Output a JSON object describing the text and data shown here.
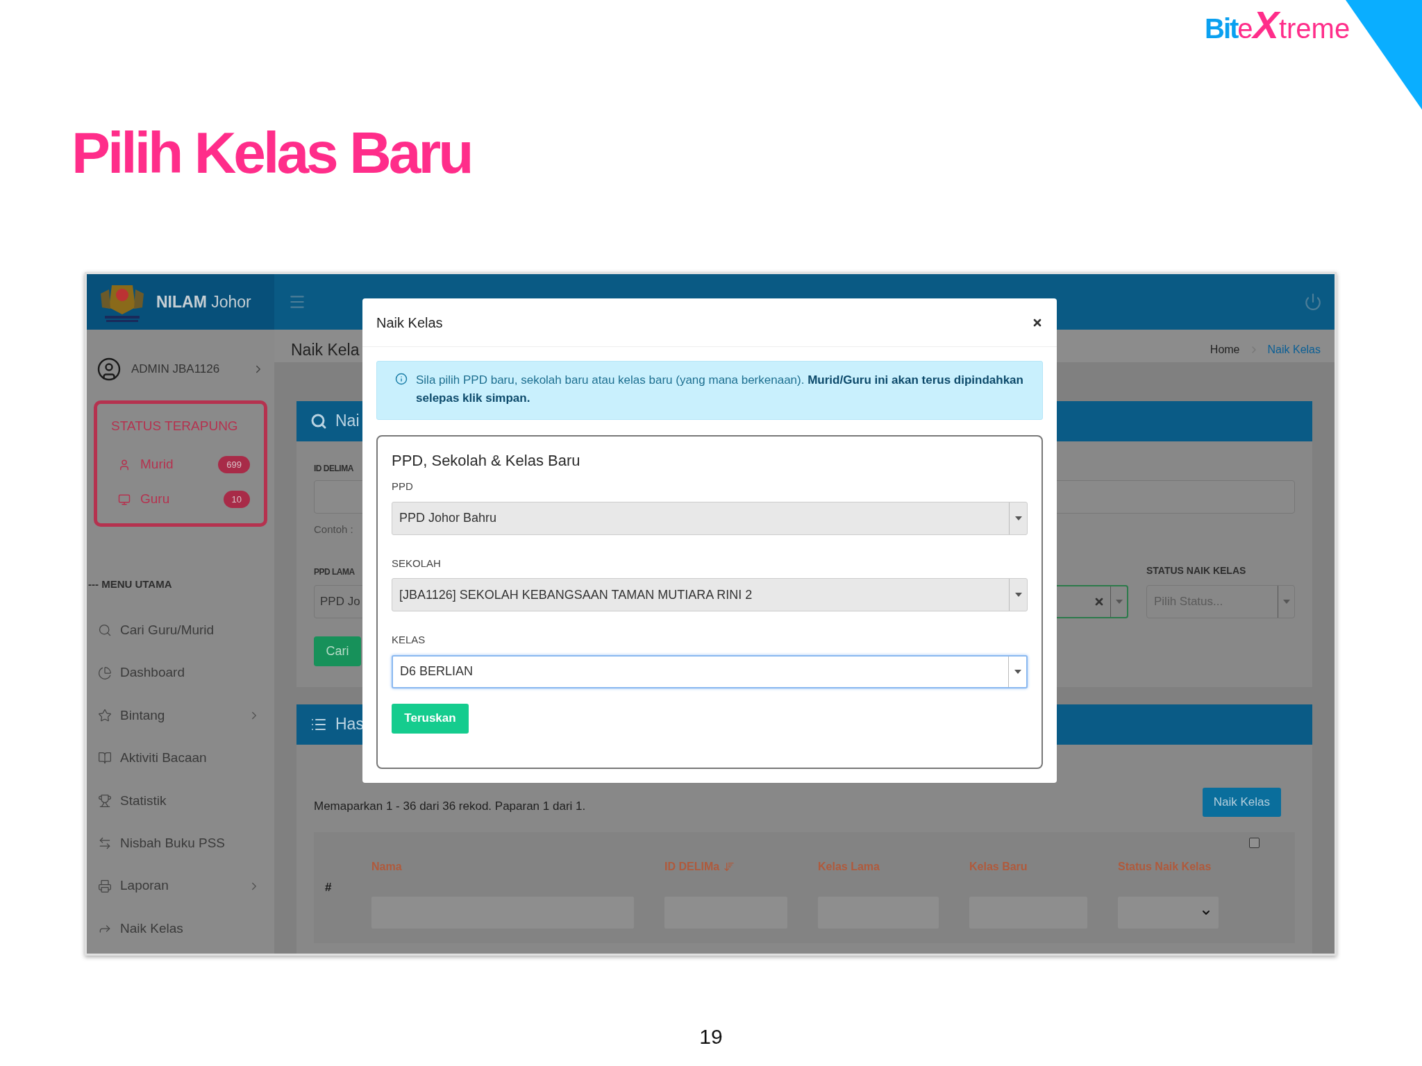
{
  "logo": {
    "parts": [
      {
        "kind": "bold",
        "text": "Bit"
      },
      {
        "kind": "light",
        "text": "e"
      },
      {
        "kind": "cross",
        "text": "X"
      },
      {
        "kind": "light",
        "text": "treme"
      }
    ]
  },
  "slide_title": "Pilih Kelas Baru",
  "app": {
    "brand": {
      "name": "NILAM",
      "region": "Johor"
    },
    "user": {
      "name": "ADMIN JBA1126"
    },
    "status_panel": {
      "title": "STATUS TERAPUNG",
      "items": [
        {
          "kind": "student",
          "label": "Murid",
          "count": "699"
        },
        {
          "kind": "teacher",
          "label": "Guru",
          "count": "10"
        }
      ]
    },
    "menu_heading": "--- MENU UTAMA",
    "menu": [
      {
        "kind": "search",
        "label": "Cari Guru/Murid",
        "has_submenu": false
      },
      {
        "kind": "dashboard",
        "label": "Dashboard",
        "has_submenu": false
      },
      {
        "kind": "star",
        "label": "Bintang",
        "has_submenu": true
      },
      {
        "kind": "book",
        "label": "Aktiviti Bacaan",
        "has_submenu": false
      },
      {
        "kind": "trophy",
        "label": "Statistik",
        "has_submenu": false
      },
      {
        "kind": "ratio",
        "label": "Nisbah Buku PSS",
        "has_submenu": false
      },
      {
        "kind": "printer",
        "label": "Laporan",
        "has_submenu": true
      },
      {
        "kind": "share",
        "label": "Naik Kelas",
        "has_submenu": false
      }
    ],
    "page_title": "Naik Kela",
    "breadcrumb": [
      {
        "label": "Home",
        "selected": false
      },
      {
        "label": "Naik Kelas",
        "selected": true
      }
    ],
    "search_card": {
      "title": "Nai",
      "id_label": "ID DELIMA",
      "hint": "Contoh :",
      "ppd_label": "PPD LAMA",
      "ppd_value": "PPD Jo",
      "status_label": "STATUS NAIK KELAS",
      "status_placeholder": "Pilih Status...",
      "button": "Cari"
    },
    "results_card": {
      "title": "Has",
      "button": "Naik Kelas",
      "summary": "Memaparkan 1 - 36 dari 36 rekod. Paparan 1 dari 1.",
      "columns": [
        "#",
        "Nama",
        "ID DELIMa",
        "Kelas Lama",
        "Kelas Baru",
        "Status Naik Kelas"
      ],
      "select_all_checked": false
    }
  },
  "modal": {
    "title": "Naik Kelas",
    "alert": "Sila pilih PPD baru, sekolah baru atau kelas baru (yang mana berkenaan). **Murid/Guru ini akan terus dipindahkan selepas klik simpan.**",
    "panel_title": "PPD, Sekolah & Kelas Baru",
    "fields": [
      {
        "label": "PPD",
        "value": "PPD Johor Bahru",
        "disabled": true,
        "focused": false
      },
      {
        "label": "SEKOLAH",
        "value": "[JBA1126] SEKOLAH KEBANGSAAN TAMAN MUTIARA RINI 2",
        "disabled": true,
        "focused": false
      },
      {
        "label": "KELAS",
        "value": "D6 BERLIAN",
        "disabled": false,
        "focused": true
      }
    ],
    "button": "Teruskan"
  },
  "page_number": "19"
}
